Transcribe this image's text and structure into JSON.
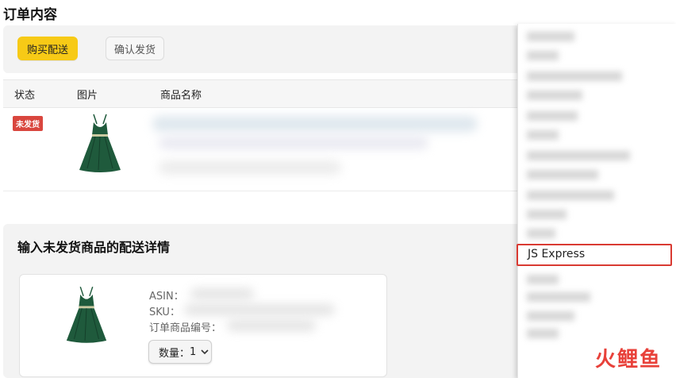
{
  "page": {
    "title": "订单内容"
  },
  "toolbar": {
    "buy_shipping_label": "购买配送",
    "confirm_shipment_label": "确认发货"
  },
  "table": {
    "headers": [
      "状态",
      "图片",
      "商品名称"
    ],
    "rows": [
      {
        "status": "未发货"
      }
    ]
  },
  "shipping_section": {
    "title": "输入未发货商品的配送详情",
    "asin_label": "ASIN：",
    "sku_label": "SKU：",
    "order_item_label": "订单商品编号：",
    "quantity_label": "数量：",
    "quantity_value": "1"
  },
  "carrier_dropdown": {
    "highlighted_option": "JS Express"
  },
  "watermark": {
    "chars": [
      "火",
      "鲤",
      "鱼"
    ]
  },
  "colors": {
    "primary_button": "#f7ca16",
    "status_badge": "#d9463e",
    "highlight_border": "#d93a32",
    "dress": "#1f5a3c"
  },
  "icons": {
    "product_image": "dress-image",
    "dropdown_arrow": "chevron-down-icon"
  }
}
